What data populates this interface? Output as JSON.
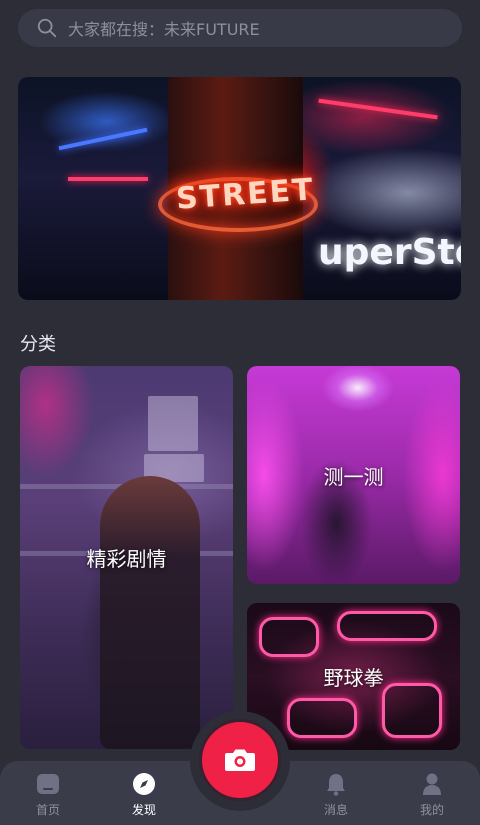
{
  "search": {
    "placeholder": "大家都在搜：未来FUTURE"
  },
  "banner": {
    "neon_text": "STREET",
    "sign_text": "uperSter"
  },
  "section": {
    "title": "分类"
  },
  "categories": [
    {
      "label": "精彩剧情"
    },
    {
      "label": "测一测"
    },
    {
      "label": "野球拳"
    }
  ],
  "tabbar": {
    "items": [
      {
        "label": "首页",
        "icon": "home-icon",
        "active": false
      },
      {
        "label": "发现",
        "icon": "compass-icon",
        "active": true
      },
      {
        "label": "消息",
        "icon": "bell-icon",
        "active": false
      },
      {
        "label": "我的",
        "icon": "user-icon",
        "active": false
      }
    ],
    "camera_icon": "camera-icon"
  },
  "colors": {
    "background": "#2c2d37",
    "accent": "#ef2147",
    "tabbar": "#3a3c4a",
    "inactive_text": "#8f91a0"
  }
}
